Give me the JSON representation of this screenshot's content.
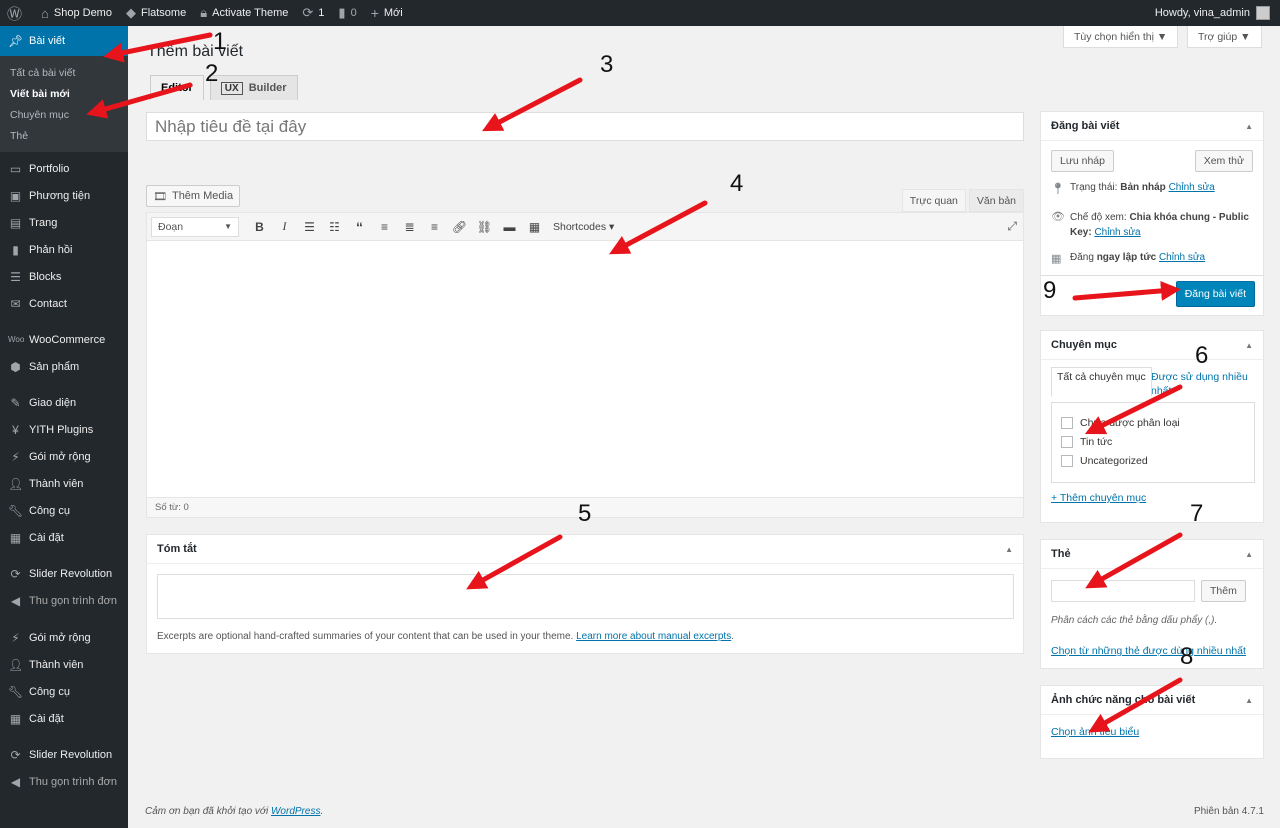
{
  "adminbar": {
    "wp_logo": "wordpress-logo",
    "site": "Shop Demo",
    "theme": "Flatsome",
    "activate": "Activate Theme",
    "updates": "1",
    "comments": "0",
    "new": "Mới",
    "howdy": "Howdy, vina_admin"
  },
  "sidebar": {
    "posts": "Bài viết",
    "sub": [
      "Tất cả bài viết",
      "Viết bài mới",
      "Chuyên mục",
      "Thẻ"
    ],
    "items": [
      "Portfolio",
      "Phương tiện",
      "Trang",
      "Phản hồi",
      "Blocks",
      "Contact"
    ],
    "items2": [
      "WooCommerce",
      "Sản phẩm"
    ],
    "items3": [
      "Giao diện",
      "YITH Plugins",
      "Gói mở rộng",
      "Thành viên",
      "Công cụ",
      "Cài đặt"
    ],
    "items4": [
      "Slider Revolution",
      "Thu gọn trình đơn"
    ],
    "items5": [
      "Gói mở rộng",
      "Thành viên",
      "Công cụ",
      "Cài đặt"
    ],
    "items6": [
      "Slider Revolution",
      "Thu gọn trình đơn"
    ]
  },
  "screen_options": "Tùy chọn hiển thị ▼",
  "help": "Trợ giúp ▼",
  "page_title": "Thêm bài viết",
  "tabs": {
    "editor": "Editor",
    "ux": "UX",
    "builder": "Builder"
  },
  "title_placeholder": "Nhập tiêu đề tại đây",
  "editor": {
    "add_media": "Thêm Media",
    "visual": "Trực quan",
    "text": "Văn bản",
    "format": "Đoạn",
    "shortcodes": "Shortcodes ▾",
    "word_count": "Số từ: 0"
  },
  "excerpt": {
    "title": "Tóm tắt",
    "help": "Excerpts are optional hand-crafted summaries of your content that can be used in your theme.",
    "learn_more": "Learn more about manual excerpts",
    "period": "."
  },
  "publish": {
    "title": "Đăng bài viết",
    "save_draft": "Lưu nháp",
    "preview": "Xem thử",
    "status_label": "Trạng thái:",
    "status_value": "Bản nháp",
    "edit": "Chỉnh sửa",
    "visibility_label": "Chế độ xem:",
    "visibility_value": "Chia khóa chung - Public Key:",
    "edit2": "Chỉnh sửa",
    "schedule_label": "Đăng",
    "schedule_value": "ngay lập tức",
    "edit3": "Chỉnh sửa",
    "publish_button": "Đăng bài viết"
  },
  "categories": {
    "title": "Chuyên mục",
    "tab_all": "Tất cả chuyên mục",
    "tab_popular": "Được sử dụng nhiều nhất",
    "items": [
      "Chưa được phân loại",
      "Tin tức",
      "Uncategorized"
    ],
    "add_new": "+ Thêm chuyên mục"
  },
  "tags": {
    "title": "Thẻ",
    "add": "Thêm",
    "help": "Phân cách các thẻ bằng dấu phẩy (,).",
    "choose": "Chọn từ những thẻ được dùng nhiều nhất"
  },
  "thumbnail": {
    "title": "Ảnh chức năng cho bài viết",
    "link": "Chọn ảnh tiêu biểu"
  },
  "footer": {
    "thanks": "Cảm ơn bạn đã khởi tạo với",
    "wordpress": "WordPress",
    "period": ".",
    "version": "Phiên bản 4.7.1"
  },
  "annotations": [
    "1",
    "2",
    "3",
    "4",
    "5",
    "6",
    "7",
    "8",
    "9"
  ],
  "colors": {
    "accent": "#0073aa",
    "adminbar": "#23282d",
    "arrow": "#e8141b"
  }
}
